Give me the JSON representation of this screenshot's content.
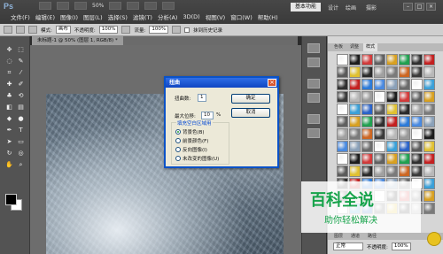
{
  "app": {
    "logo": "Ps"
  },
  "menu": [
    "文件(F)",
    "编辑(E)",
    "图像(I)",
    "图层(L)",
    "选择(S)",
    "滤镜(T)",
    "分析(A)",
    "3D(D)",
    "视图(V)",
    "窗口(W)",
    "帮助(H)"
  ],
  "top_toolbar": {
    "zoom": "50%"
  },
  "workspace": {
    "active": "基本功能",
    "tabs": [
      "设计",
      "绘画",
      "摄影"
    ]
  },
  "options_bar": {
    "mode_label": "模式:",
    "mode_value": "画布",
    "opacity_label": "不透明度:",
    "opacity_value": "100%",
    "flow_label": "流量:",
    "flow_value": "100%",
    "history_label": "抹到历史记录"
  },
  "document": {
    "tab_label": "未标题-1 @ 50% (图层 1, RGB/8) *"
  },
  "panel": {
    "tabs": [
      "色板",
      "调整",
      "样式"
    ],
    "active_tab": "样式"
  },
  "layers": {
    "tabs": [
      "图层",
      "通道",
      "路径"
    ],
    "blend_mode": "正常",
    "opacity_label": "不透明度:",
    "opacity_value": "100%"
  },
  "dialog": {
    "title": "扭曲",
    "amount_label": "扭曲数:",
    "amount_value": "1",
    "maxdisp_label": "最大位移:",
    "maxdisp_value": "10",
    "maxdisp_unit": "%",
    "group_title": "填充空白区域用",
    "options": [
      "背景色(B)",
      "前景颜色(F)",
      "反向图像(I)",
      "未改变的图像(U)"
    ],
    "selected_index": 0,
    "ok": "确定",
    "cancel": "取消"
  },
  "watermark": {
    "title": "百科全说",
    "subtitle": "助你轻松解决"
  },
  "colors": {
    "accent_blue": "#0a52c8",
    "watermark_green": "#16a34a"
  }
}
